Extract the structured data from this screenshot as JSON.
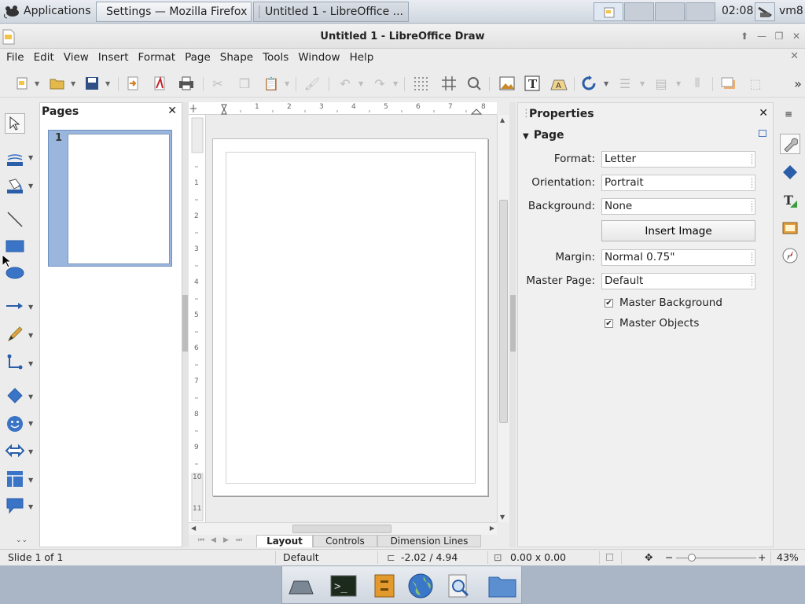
{
  "top_panel": {
    "apps_label": "Applications",
    "tasks": [
      {
        "label": "Settings — Mozilla Firefox"
      },
      {
        "label": "Untitled 1 - LibreOffice ..."
      }
    ],
    "clock": "02:08",
    "user": "vm8"
  },
  "window": {
    "title": "Untitled 1 - LibreOffice Draw"
  },
  "menu": [
    "File",
    "Edit",
    "View",
    "Insert",
    "Format",
    "Page",
    "Shape",
    "Tools",
    "Window",
    "Help"
  ],
  "pages_pane": {
    "title": "Pages",
    "thumb_number": "1"
  },
  "ruler": {
    "h": [
      "1",
      "2",
      "3",
      "4",
      "5",
      "6",
      "7",
      "8"
    ],
    "v": [
      "1",
      "2",
      "3",
      "4",
      "5",
      "6",
      "7",
      "8",
      "9",
      "10",
      "11"
    ]
  },
  "tabs": [
    "Layout",
    "Controls",
    "Dimension Lines"
  ],
  "properties": {
    "title": "Properties",
    "section": "Page",
    "format_label": "Format:",
    "format_value": "Letter",
    "orientation_label": "Orientation:",
    "orientation_value": "Portrait",
    "background_label": "Background:",
    "background_value": "None",
    "insert_image": "Insert Image",
    "margin_label": "Margin:",
    "margin_value": "Normal 0.75\"",
    "master_page_label": "Master Page:",
    "master_page_value": "Default",
    "master_background": "Master Background",
    "master_objects": "Master Objects"
  },
  "status": {
    "slide": "Slide 1 of 1",
    "master": "Default",
    "position": "-2.02 / 4.94",
    "size": "0.00 x 0.00",
    "zoom": "43%"
  },
  "colors": {
    "accent": "#2a5ea8",
    "selection": "#9bb6dc"
  }
}
